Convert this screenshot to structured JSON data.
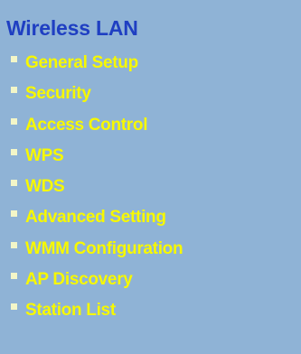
{
  "colors": {
    "background": "#8fb3d6",
    "title": "#1f3fc2",
    "menu_text": "#f7f800",
    "bullet": "#f3f6c8"
  },
  "section": {
    "title": "Wireless LAN"
  },
  "menu": {
    "items": [
      {
        "label": "General Setup"
      },
      {
        "label": "Security"
      },
      {
        "label": "Access Control"
      },
      {
        "label": "WPS"
      },
      {
        "label": "WDS"
      },
      {
        "label": "Advanced Setting"
      },
      {
        "label": "WMM Configuration"
      },
      {
        "label": "AP Discovery"
      },
      {
        "label": "Station List"
      }
    ]
  }
}
